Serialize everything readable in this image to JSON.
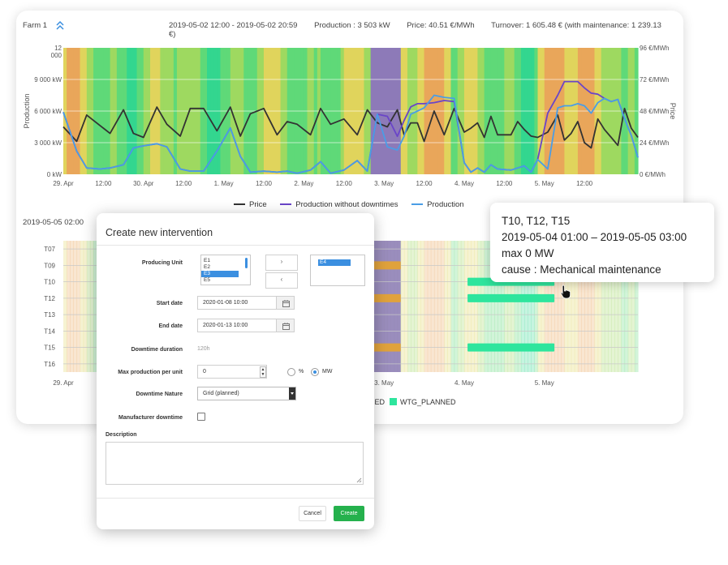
{
  "header": {
    "farm_label": "Farm 1",
    "period": "2019-05-02 12:00 - 2019-05-02 20:59",
    "production": "Production : 3 503 kW",
    "price": "Price: 40.51 €/MWh",
    "turnover": "Turnover: 1 605.48 € (with maintenance: 1 239.13 €)"
  },
  "chart_data": [
    {
      "type": "line",
      "title": "",
      "ylabel": "Production",
      "y2label": "Price",
      "yticks": [
        "12 000 kW",
        "9 000 kW",
        "6 000 kW",
        "3 000 kW",
        "0 kW"
      ],
      "y2ticks": [
        "96 €/MWh",
        "72 €/MWh",
        "48 €/MWh",
        "24 €/MWh",
        "0 €/MWh"
      ],
      "xticks": [
        "29. Apr",
        "12:00",
        "30. Apr",
        "12:00",
        "1. May",
        "12:00",
        "2. May",
        "12:00",
        "3. May",
        "12:00",
        "4. May",
        "12:00",
        "5. May",
        "12:00"
      ],
      "ylim": [
        0,
        12000
      ],
      "y2lim": [
        0,
        96
      ],
      "x_range_hours": [
        0,
        172
      ],
      "highlight_band_hours": [
        92,
        101
      ],
      "legend_position": "bottom",
      "series": [
        {
          "name": "Price",
          "axis": "right",
          "color": "#333333",
          "x_hours": [
            0,
            4,
            7,
            11,
            14,
            18,
            21,
            24,
            28,
            31,
            35,
            38,
            42,
            46,
            50,
            53,
            56,
            60,
            64,
            67,
            70,
            74,
            77,
            80,
            84,
            88,
            91,
            94,
            97,
            100,
            102,
            104,
            106,
            108,
            111,
            114,
            117,
            120,
            122,
            124,
            126,
            128,
            130,
            134,
            136,
            138,
            140,
            142,
            145,
            148,
            150,
            152,
            154,
            156,
            158,
            160,
            162,
            164,
            166,
            168,
            170,
            172
          ],
          "values": [
            36,
            25,
            45,
            37,
            31,
            49,
            31,
            28,
            51,
            38,
            29,
            50,
            50,
            33,
            51,
            29,
            46,
            50,
            30,
            40,
            38,
            30,
            50,
            38,
            42,
            30,
            49,
            39,
            36,
            49,
            30,
            39,
            39,
            25,
            48,
            30,
            50,
            32,
            35,
            39,
            28,
            44,
            30,
            30,
            40,
            34,
            29,
            28,
            32,
            45,
            26,
            31,
            40,
            24,
            20,
            42,
            34,
            28,
            22,
            50,
            35,
            28
          ]
        },
        {
          "name": "Production without downtimes",
          "axis": "left",
          "color": "#6a45c8",
          "x_hours": [
            0,
            4,
            7,
            11,
            14,
            18,
            21,
            24,
            28,
            31,
            35,
            38,
            42,
            46,
            50,
            53,
            56,
            60,
            64,
            67,
            70,
            74,
            77,
            80,
            84,
            88,
            91,
            94,
            97,
            100,
            102,
            104,
            106,
            108,
            111,
            114,
            117,
            120,
            122,
            124,
            126,
            128,
            130,
            134,
            136,
            138,
            140,
            142,
            145,
            148,
            150,
            152,
            154,
            156,
            158,
            160,
            162,
            164,
            166,
            168,
            170,
            172
          ],
          "values": [
            5900,
            2200,
            600,
            500,
            600,
            900,
            2500,
            2700,
            2900,
            2600,
            500,
            300,
            300,
            2200,
            4400,
            1700,
            200,
            300,
            200,
            300,
            100,
            400,
            1200,
            100,
            400,
            1300,
            300,
            5700,
            5500,
            3600,
            5100,
            6400,
            6700,
            6700,
            6800,
            7000,
            6900,
            1100,
            200,
            600,
            200,
            900,
            500,
            400,
            600,
            800,
            200,
            1400,
            5800,
            7500,
            8800,
            8800,
            8800,
            8200,
            7700,
            7600,
            7200,
            6900,
            7100,
            5300,
            3700,
            1600
          ]
        },
        {
          "name": "Production",
          "axis": "left",
          "color": "#4a9de6",
          "x_hours": [
            0,
            4,
            7,
            11,
            14,
            18,
            21,
            24,
            28,
            31,
            35,
            38,
            42,
            46,
            50,
            53,
            56,
            60,
            64,
            67,
            70,
            74,
            77,
            80,
            84,
            88,
            91,
            94,
            97,
            100,
            102,
            104,
            106,
            108,
            111,
            114,
            117,
            120,
            122,
            124,
            126,
            128,
            130,
            134,
            136,
            138,
            140,
            142,
            145,
            148,
            150,
            152,
            154,
            156,
            158,
            160,
            162,
            164,
            166,
            168,
            170,
            172
          ],
          "values": [
            5900,
            2200,
            600,
            500,
            600,
            900,
            2500,
            2700,
            2900,
            2600,
            500,
            300,
            300,
            2200,
            4400,
            1700,
            200,
            300,
            200,
            300,
            100,
            400,
            1200,
            100,
            400,
            1300,
            300,
            5700,
            2600,
            2300,
            3600,
            5700,
            6000,
            6300,
            7500,
            7300,
            7200,
            1100,
            200,
            600,
            200,
            900,
            500,
            400,
            600,
            800,
            200,
            1400,
            500,
            6300,
            6500,
            6500,
            6700,
            6500,
            5800,
            6800,
            7200,
            6900,
            7100,
            5300,
            3700,
            1600
          ]
        }
      ]
    },
    {
      "type": "timeline",
      "title": "",
      "row_labels": [
        "T07",
        "T09",
        "T10",
        "T12",
        "T13",
        "T14",
        "T15",
        "T16"
      ],
      "xticks": [
        "29. Apr",
        "3. May",
        "4. May",
        "5. May"
      ],
      "x_range_hours": [
        0,
        172
      ],
      "highlight_band_hours": [
        92,
        101
      ],
      "legend_entries": [
        "WTG_FORCED",
        "WTG_PLANNED"
      ],
      "bars": [
        {
          "row": "T09",
          "start_hours": 92,
          "end_hours": 101,
          "color": "#e0a23c"
        },
        {
          "row": "T12",
          "start_hours": 92,
          "end_hours": 101,
          "color": "#e0a23c"
        },
        {
          "row": "T15",
          "start_hours": 92,
          "end_hours": 101,
          "color": "#e0a23c"
        },
        {
          "row": "T10",
          "start_hours": 121,
          "end_hours": 147,
          "color": "#2ee59d"
        },
        {
          "row": "T12",
          "start_hours": 121,
          "end_hours": 147,
          "color": "#2ee59d"
        },
        {
          "row": "T15",
          "start_hours": 121,
          "end_hours": 147,
          "color": "#2ee59d"
        }
      ]
    }
  ],
  "chart2": {
    "date_label": "2019-05-05 02:00",
    "legend_partial_1": "CED",
    "legend_2": "WTG_PLANNED"
  },
  "tooltip": {
    "line1": "T10, T12, T15",
    "line2": "2019-05-04 01:00 – 2019-05-05 03:00",
    "line3": "max 0 MW",
    "line4": "cause : Mechanical maintenance"
  },
  "modal": {
    "title": "Create new intervention",
    "producing_unit_label": "Producing Unit",
    "units_list": [
      "E1",
      "E2",
      "E3",
      "E5"
    ],
    "selected_list": [
      "E4"
    ],
    "move_right": "›",
    "move_left": "‹",
    "start_date_label": "Start date",
    "start_date": "2020-01-08 10:00",
    "end_date_label": "End date",
    "end_date": "2020-01-13 10:00",
    "duration_label": "Downtime duration",
    "duration": "120h",
    "max_prod_label": "Max production per unit",
    "max_prod_value": "0",
    "unit_percent": "%",
    "unit_mw": "MW",
    "nature_label": "Downtime Nature",
    "nature_value": "Grid (planned)",
    "manufacturer_label": "Manufacturer downtime",
    "description_label": "Description",
    "cancel": "Cancel",
    "create": "Create"
  },
  "colors": {
    "accent_blue": "#3b8fe0",
    "create_green": "#25b14d",
    "planned_green": "#2ee59d",
    "forced_orange": "#e0a23c"
  }
}
